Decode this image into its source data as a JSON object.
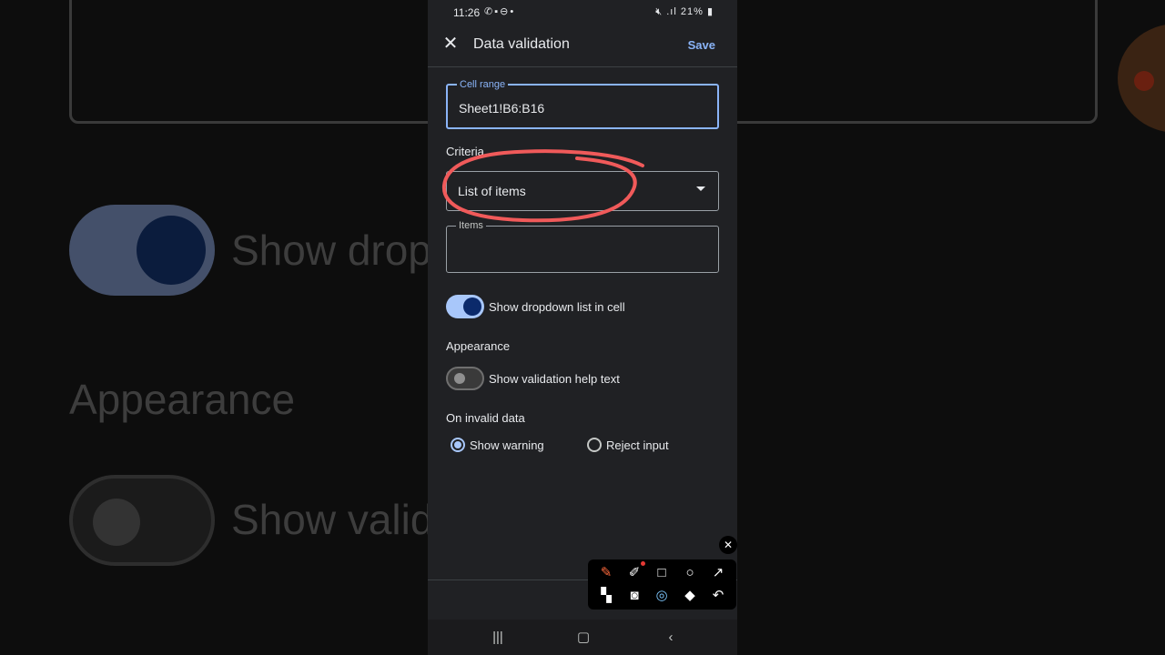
{
  "background": {
    "text_dropdown": "Show drop",
    "text_appearance": "Appearance",
    "text_validation": "Show valid"
  },
  "status_bar": {
    "time": "11:26",
    "battery": "21%"
  },
  "app_bar": {
    "title": "Data validation",
    "save_label": "Save"
  },
  "cell_range": {
    "label": "Cell range",
    "value": "Sheet1!B6:B16"
  },
  "criteria": {
    "label": "Criteria",
    "selected": "List of items"
  },
  "items_field": {
    "label": "Items",
    "value": ""
  },
  "dropdown_toggle": {
    "label": "Show dropdown list in cell",
    "on": true
  },
  "appearance": {
    "label": "Appearance",
    "help_toggle_label": "Show validation help text",
    "on": false
  },
  "invalid_data": {
    "label": "On invalid data",
    "options": [
      "Show warning",
      "Reject input"
    ],
    "selected": "Show warning"
  },
  "colors": {
    "accent": "#8ab4f8",
    "annotation": "#f05a5a",
    "surface": "#202124"
  },
  "icons": {
    "close": "close-icon",
    "dropdown": "chevron-down-icon"
  }
}
